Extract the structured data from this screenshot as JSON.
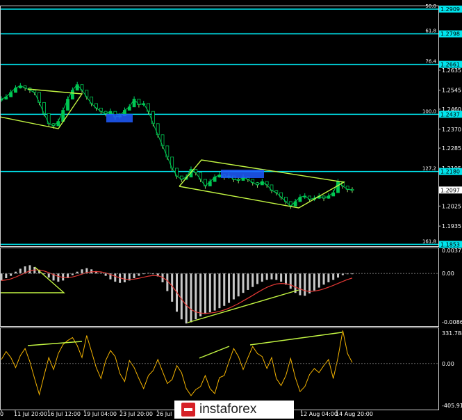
{
  "chart_data": [
    {
      "type": "candlestick",
      "panel": "price",
      "price_ticks": [
        1.2909,
        1.2798,
        1.2635,
        1.2545,
        1.246,
        1.237,
        1.2285,
        1.2195,
        1.2025,
        1.1935
      ],
      "ylim": [
        1.1845,
        1.2925
      ],
      "fib_levels": [
        {
          "ratio": "50.0",
          "price": "1.2909",
          "value": 1.2909
        },
        {
          "ratio": "61.8",
          "price": "1.2798",
          "value": 1.2798
        },
        {
          "ratio": "76.4",
          "price": "1.2661",
          "value": 1.2661
        },
        {
          "ratio": "100.0",
          "price": "1.2437",
          "value": 1.2437
        },
        {
          "ratio": "127.2",
          "price": "1.2180",
          "value": 1.218
        },
        {
          "ratio": "161.8",
          "price": "1.1853",
          "value": 1.1853
        }
      ],
      "current_price": "1.2097",
      "current_value": 1.2097,
      "x_labels": [
        "0",
        "11 Jul 20:00",
        "16 Jul 12:00",
        "19 Jul 04:00",
        "23 Jul 20:00",
        "26 Jul",
        "12 Aug 04:00",
        "14 Aug 20:00"
      ],
      "close_path": [
        1.2505,
        1.2515,
        1.2535,
        1.2555,
        1.2565,
        1.2555,
        1.2545,
        1.2535,
        1.249,
        1.244,
        1.2395,
        1.2385,
        1.2405,
        1.2455,
        1.2505,
        1.2545,
        1.257,
        1.2545,
        1.2515,
        1.2485,
        1.2465,
        1.245,
        1.244,
        1.245,
        1.2425,
        1.243,
        1.2455,
        1.247,
        1.2505,
        1.248,
        1.2485,
        1.245,
        1.2395,
        1.2345,
        1.2295,
        1.2245,
        1.2195,
        1.216,
        1.2145,
        1.2155,
        1.219,
        1.2175,
        1.2145,
        1.2115,
        1.2135,
        1.2155,
        1.2165,
        1.2155,
        1.216,
        1.2145,
        1.214,
        1.2155,
        1.2145,
        1.213,
        1.212,
        1.2135,
        1.212,
        1.2095,
        1.2085,
        1.2065,
        1.2045,
        1.2025,
        1.2045,
        1.2065,
        1.207,
        1.2055,
        1.206,
        1.207,
        1.206,
        1.207,
        1.2085,
        1.2135,
        1.2115,
        1.21,
        1.2097
      ]
    },
    {
      "type": "bar",
      "panel": "macd",
      "ticks": [
        "0.00373",
        "0.00",
        "-0.00863"
      ],
      "ylim": [
        -0.00895,
        0.0044
      ],
      "values": [
        -0.0012,
        -0.0008,
        -0.0004,
        0.0003,
        0.0008,
        0.0012,
        0.0014,
        0.0011,
        0.0006,
        -0.0001,
        -0.0007,
        -0.0012,
        -0.0014,
        -0.0012,
        -0.0008,
        -0.0003,
        0.0003,
        0.0007,
        0.0009,
        0.0007,
        0.0004,
        0.0001,
        -0.0004,
        -0.001,
        -0.0014,
        -0.0016,
        -0.0015,
        -0.0012,
        -0.0008,
        -0.0004,
        -0.0001,
        0.0001,
        0.0,
        -0.0005,
        -0.0015,
        -0.003,
        -0.0048,
        -0.0065,
        -0.0078,
        -0.0085,
        -0.0083,
        -0.0078,
        -0.0073,
        -0.0069,
        -0.0066,
        -0.0063,
        -0.0059,
        -0.0055,
        -0.005,
        -0.0044,
        -0.0039,
        -0.0033,
        -0.0028,
        -0.0023,
        -0.0018,
        -0.0014,
        -0.0011,
        -0.001,
        -0.0011,
        -0.0014,
        -0.0019,
        -0.0026,
        -0.0033,
        -0.0037,
        -0.0038,
        -0.0034,
        -0.0029,
        -0.0024,
        -0.0019,
        -0.0015,
        -0.0011,
        -0.0007,
        -0.0003,
        -0.0001,
        0.0
      ]
    },
    {
      "type": "line",
      "panel": "cci",
      "ticks": [
        "331.7881",
        "0.00",
        "-405.918"
      ],
      "ylim": [
        -460,
        360
      ],
      "values": [
        40,
        120,
        60,
        -40,
        80,
        150,
        20,
        -150,
        -310,
        -120,
        60,
        -60,
        100,
        190,
        230,
        260,
        180,
        60,
        280,
        120,
        -40,
        -150,
        30,
        130,
        70,
        -100,
        -180,
        30,
        -40,
        -150,
        -250,
        -120,
        -70,
        40,
        -80,
        -200,
        -160,
        -20,
        -90,
        -250,
        -320,
        -260,
        -230,
        -120,
        -250,
        -300,
        -140,
        -120,
        20,
        150,
        70,
        -60,
        60,
        170,
        100,
        70,
        -50,
        60,
        -150,
        -220,
        -120,
        50,
        -140,
        -280,
        -230,
        -110,
        -50,
        -90,
        -20,
        40,
        -150,
        60,
        330,
        100,
        10
      ]
    }
  ],
  "watermark": {
    "text": "instaforex",
    "icon": "instaforex-logo-icon"
  },
  "colors": {
    "background": "#000000",
    "fib": "#00e5ee",
    "trendline": "#c2f542",
    "signal": "#e53935",
    "cci": "#f5b400",
    "histogram": "#c8c8c8"
  }
}
